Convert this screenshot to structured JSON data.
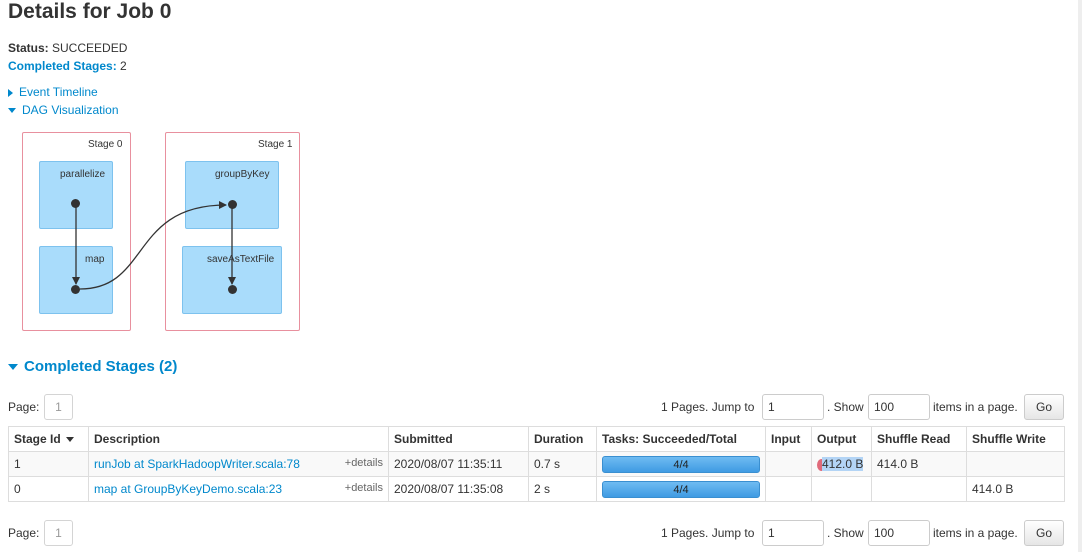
{
  "page": {
    "title": "Details for Job 0",
    "status_label": "Status:",
    "status_value": "SUCCEEDED",
    "completed_stages_label": "Completed Stages:",
    "completed_stages_value": "2"
  },
  "expanders": {
    "event_timeline": "Event Timeline",
    "dag_visualization": "DAG Visualization"
  },
  "dag": {
    "stages": [
      {
        "label": "Stage 0",
        "rdds": [
          "parallelize",
          "map"
        ]
      },
      {
        "label": "Stage 1",
        "rdds": [
          "groupByKey",
          "saveAsTextFile"
        ]
      }
    ],
    "colors": {
      "stage_border": "#e8909e",
      "rdd_fill": "#a9dcfb",
      "edge": "#333333"
    }
  },
  "completed_section": {
    "title": "Completed Stages (2)"
  },
  "pager": {
    "page_label": "Page:",
    "current_page": "1",
    "summary": "1 Pages. Jump to",
    "jump_value": "1",
    "show_label": ". Show",
    "show_value": "100",
    "items_label": "items in a page.",
    "go_label": "Go"
  },
  "table": {
    "headers": [
      "Stage Id",
      "Description",
      "Submitted",
      "Duration",
      "Tasks: Succeeded/Total",
      "Input",
      "Output",
      "Shuffle Read",
      "Shuffle Write"
    ],
    "rows": [
      {
        "stage_id": "1",
        "description": "runJob at SparkHadoopWriter.scala:78",
        "details": "+details",
        "submitted": "2020/08/07 11:35:11",
        "duration": "0.7 s",
        "tasks": "4/4",
        "tasks_fraction": 1.0,
        "input": "",
        "output": "412.0 B",
        "shuffle_read": "414.0 B",
        "shuffle_write": ""
      },
      {
        "stage_id": "0",
        "description": "map at GroupByKeyDemo.scala:23",
        "details": "+details",
        "submitted": "2020/08/07 11:35:08",
        "duration": "2 s",
        "tasks": "4/4",
        "tasks_fraction": 1.0,
        "input": "",
        "output": "",
        "shuffle_read": "",
        "shuffle_write": "414.0 B"
      }
    ]
  }
}
